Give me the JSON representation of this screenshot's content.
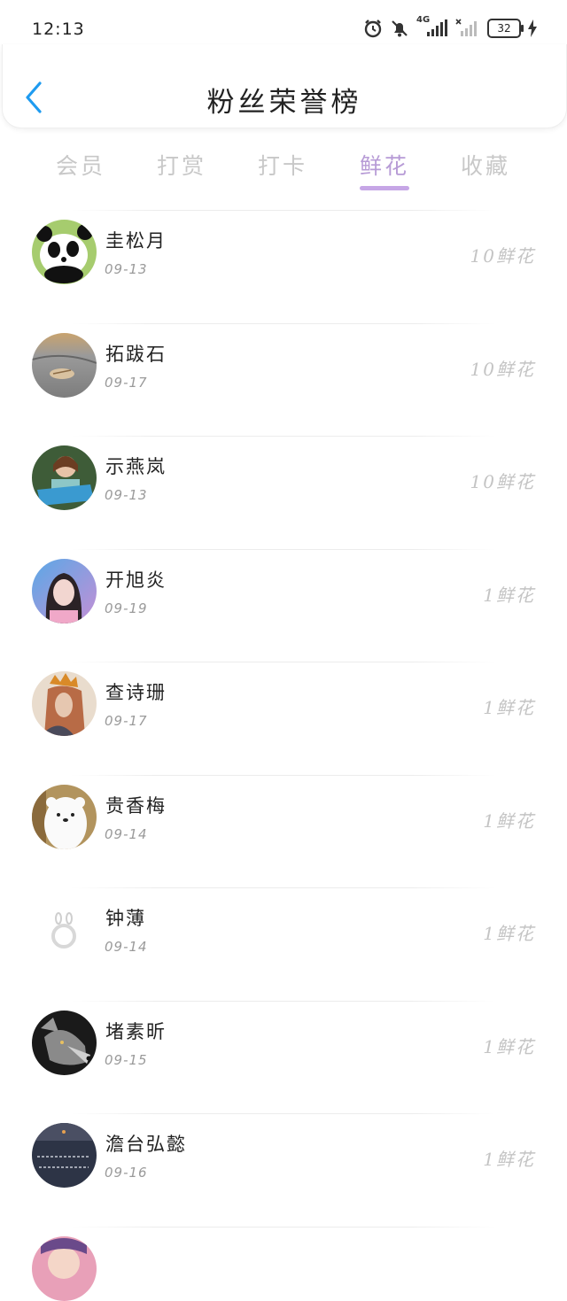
{
  "status": {
    "time": "12:13",
    "network": "4G",
    "battery": "32"
  },
  "header": {
    "title": "粉丝荣誉榜"
  },
  "tabs": [
    {
      "label": "会员"
    },
    {
      "label": "打赏"
    },
    {
      "label": "打卡"
    },
    {
      "label": "鲜花"
    },
    {
      "label": "收藏"
    }
  ],
  "active_tab": "鲜花",
  "accent_color": "#b79bd6",
  "fans": [
    {
      "name": "圭松月",
      "date": "09-13",
      "gift": "10鲜花",
      "avatar": "panda-avatar"
    },
    {
      "name": "拓跋石",
      "date": "09-17",
      "gift": "10鲜花",
      "avatar": "shell-beach-avatar"
    },
    {
      "name": "示燕岚",
      "date": "09-13",
      "gift": "10鲜花",
      "avatar": "girl-reading-avatar"
    },
    {
      "name": "开旭炎",
      "date": "09-19",
      "gift": "1鲜花",
      "avatar": "girl-portrait-avatar"
    },
    {
      "name": "查诗珊",
      "date": "09-17",
      "gift": "1鲜花",
      "avatar": "crowned-figure-avatar"
    },
    {
      "name": "贵香梅",
      "date": "09-14",
      "gift": "1鲜花",
      "avatar": "white-bear-avatar"
    },
    {
      "name": "钟薄",
      "date": "09-14",
      "gift": "1鲜花",
      "avatar": "bunny-ring-avatar"
    },
    {
      "name": "堵素昕",
      "date": "09-15",
      "gift": "1鲜花",
      "avatar": "wolf-avatar"
    },
    {
      "name": "澹台弘懿",
      "date": "09-16",
      "gift": "1鲜花",
      "avatar": "chalkboard-avatar"
    }
  ]
}
